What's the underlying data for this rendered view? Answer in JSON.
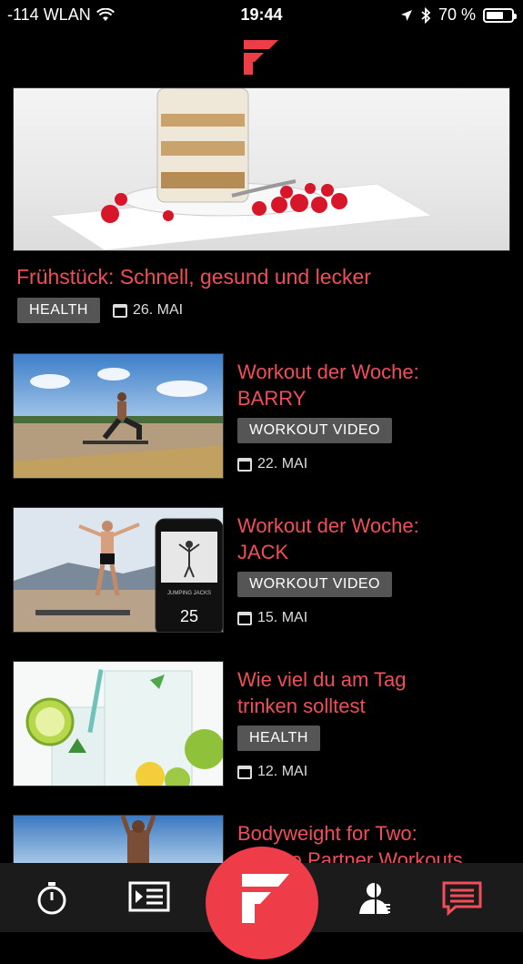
{
  "status": {
    "signal": "-114 WLAN",
    "time": "19:44",
    "battery": "70 %",
    "battery_level": 0.7
  },
  "colors": {
    "accent": "#f04e58",
    "tag_bg": "#555555",
    "tabbar_bg": "#1b1b1b"
  },
  "hero": {
    "title": "Frühstück: Schnell, gesund und lecker",
    "tag": "HEALTH",
    "date": "26. MAI"
  },
  "articles": [
    {
      "title_line1": "Workout der Woche:",
      "title_line2": "BARRY",
      "tag": "WORKOUT VIDEO",
      "date": "22. MAI"
    },
    {
      "title_line1": "Workout der Woche:",
      "title_line2": "JACK",
      "tag": "WORKOUT VIDEO",
      "date": "15. MAI",
      "phone_counter": "25",
      "phone_label": "JUMPING JACKS"
    },
    {
      "title_line1": "Wie viel du am Tag",
      "title_line2": "trinken solltest",
      "tag": "HEALTH",
      "date": "12. MAI"
    },
    {
      "title_line1": "Bodyweight for Two:",
      "title_line2": "Unsere Partner Workouts"
    }
  ],
  "tabbar": {
    "icons": [
      "stopwatch-icon",
      "video-list-icon",
      "freeletics-logo-icon",
      "coach-profile-icon",
      "news-feed-icon"
    ],
    "active": "news-feed-icon"
  }
}
